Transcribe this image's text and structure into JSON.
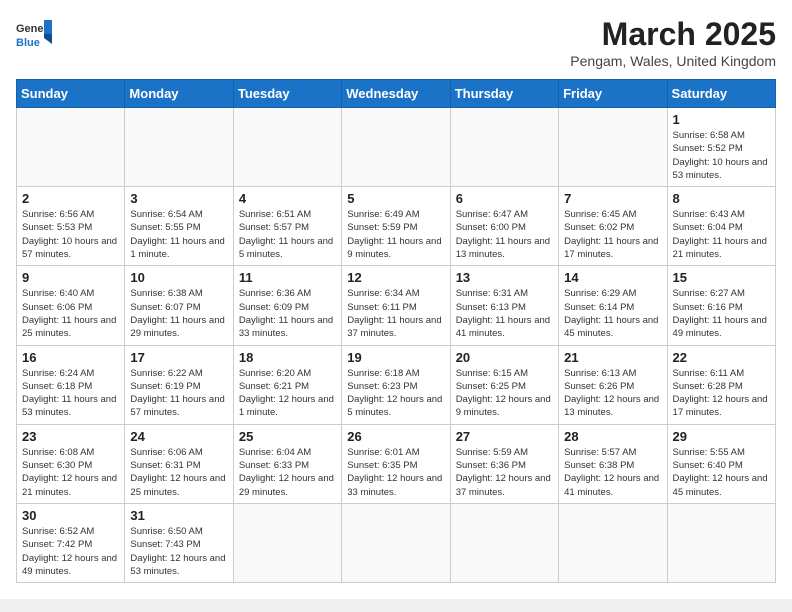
{
  "header": {
    "logo_general": "General",
    "logo_blue": "Blue",
    "title": "March 2025",
    "subtitle": "Pengam, Wales, United Kingdom"
  },
  "days_of_week": [
    "Sunday",
    "Monday",
    "Tuesday",
    "Wednesday",
    "Thursday",
    "Friday",
    "Saturday"
  ],
  "weeks": [
    [
      {
        "day": "",
        "info": ""
      },
      {
        "day": "",
        "info": ""
      },
      {
        "day": "",
        "info": ""
      },
      {
        "day": "",
        "info": ""
      },
      {
        "day": "",
        "info": ""
      },
      {
        "day": "",
        "info": ""
      },
      {
        "day": "1",
        "info": "Sunrise: 6:58 AM\nSunset: 5:52 PM\nDaylight: 10 hours\nand 53 minutes."
      }
    ],
    [
      {
        "day": "2",
        "info": "Sunrise: 6:56 AM\nSunset: 5:53 PM\nDaylight: 10 hours\nand 57 minutes."
      },
      {
        "day": "3",
        "info": "Sunrise: 6:54 AM\nSunset: 5:55 PM\nDaylight: 11 hours\nand 1 minute."
      },
      {
        "day": "4",
        "info": "Sunrise: 6:51 AM\nSunset: 5:57 PM\nDaylight: 11 hours\nand 5 minutes."
      },
      {
        "day": "5",
        "info": "Sunrise: 6:49 AM\nSunset: 5:59 PM\nDaylight: 11 hours\nand 9 minutes."
      },
      {
        "day": "6",
        "info": "Sunrise: 6:47 AM\nSunset: 6:00 PM\nDaylight: 11 hours\nand 13 minutes."
      },
      {
        "day": "7",
        "info": "Sunrise: 6:45 AM\nSunset: 6:02 PM\nDaylight: 11 hours\nand 17 minutes."
      },
      {
        "day": "8",
        "info": "Sunrise: 6:43 AM\nSunset: 6:04 PM\nDaylight: 11 hours\nand 21 minutes."
      }
    ],
    [
      {
        "day": "9",
        "info": "Sunrise: 6:40 AM\nSunset: 6:06 PM\nDaylight: 11 hours\nand 25 minutes."
      },
      {
        "day": "10",
        "info": "Sunrise: 6:38 AM\nSunset: 6:07 PM\nDaylight: 11 hours\nand 29 minutes."
      },
      {
        "day": "11",
        "info": "Sunrise: 6:36 AM\nSunset: 6:09 PM\nDaylight: 11 hours\nand 33 minutes."
      },
      {
        "day": "12",
        "info": "Sunrise: 6:34 AM\nSunset: 6:11 PM\nDaylight: 11 hours\nand 37 minutes."
      },
      {
        "day": "13",
        "info": "Sunrise: 6:31 AM\nSunset: 6:13 PM\nDaylight: 11 hours\nand 41 minutes."
      },
      {
        "day": "14",
        "info": "Sunrise: 6:29 AM\nSunset: 6:14 PM\nDaylight: 11 hours\nand 45 minutes."
      },
      {
        "day": "15",
        "info": "Sunrise: 6:27 AM\nSunset: 6:16 PM\nDaylight: 11 hours\nand 49 minutes."
      }
    ],
    [
      {
        "day": "16",
        "info": "Sunrise: 6:24 AM\nSunset: 6:18 PM\nDaylight: 11 hours\nand 53 minutes."
      },
      {
        "day": "17",
        "info": "Sunrise: 6:22 AM\nSunset: 6:19 PM\nDaylight: 11 hours\nand 57 minutes."
      },
      {
        "day": "18",
        "info": "Sunrise: 6:20 AM\nSunset: 6:21 PM\nDaylight: 12 hours\nand 1 minute."
      },
      {
        "day": "19",
        "info": "Sunrise: 6:18 AM\nSunset: 6:23 PM\nDaylight: 12 hours\nand 5 minutes."
      },
      {
        "day": "20",
        "info": "Sunrise: 6:15 AM\nSunset: 6:25 PM\nDaylight: 12 hours\nand 9 minutes."
      },
      {
        "day": "21",
        "info": "Sunrise: 6:13 AM\nSunset: 6:26 PM\nDaylight: 12 hours\nand 13 minutes."
      },
      {
        "day": "22",
        "info": "Sunrise: 6:11 AM\nSunset: 6:28 PM\nDaylight: 12 hours\nand 17 minutes."
      }
    ],
    [
      {
        "day": "23",
        "info": "Sunrise: 6:08 AM\nSunset: 6:30 PM\nDaylight: 12 hours\nand 21 minutes."
      },
      {
        "day": "24",
        "info": "Sunrise: 6:06 AM\nSunset: 6:31 PM\nDaylight: 12 hours\nand 25 minutes."
      },
      {
        "day": "25",
        "info": "Sunrise: 6:04 AM\nSunset: 6:33 PM\nDaylight: 12 hours\nand 29 minutes."
      },
      {
        "day": "26",
        "info": "Sunrise: 6:01 AM\nSunset: 6:35 PM\nDaylight: 12 hours\nand 33 minutes."
      },
      {
        "day": "27",
        "info": "Sunrise: 5:59 AM\nSunset: 6:36 PM\nDaylight: 12 hours\nand 37 minutes."
      },
      {
        "day": "28",
        "info": "Sunrise: 5:57 AM\nSunset: 6:38 PM\nDaylight: 12 hours\nand 41 minutes."
      },
      {
        "day": "29",
        "info": "Sunrise: 5:55 AM\nSunset: 6:40 PM\nDaylight: 12 hours\nand 45 minutes."
      }
    ],
    [
      {
        "day": "30",
        "info": "Sunrise: 6:52 AM\nSunset: 7:42 PM\nDaylight: 12 hours\nand 49 minutes."
      },
      {
        "day": "31",
        "info": "Sunrise: 6:50 AM\nSunset: 7:43 PM\nDaylight: 12 hours\nand 53 minutes."
      },
      {
        "day": "",
        "info": ""
      },
      {
        "day": "",
        "info": ""
      },
      {
        "day": "",
        "info": ""
      },
      {
        "day": "",
        "info": ""
      },
      {
        "day": "",
        "info": ""
      }
    ]
  ]
}
